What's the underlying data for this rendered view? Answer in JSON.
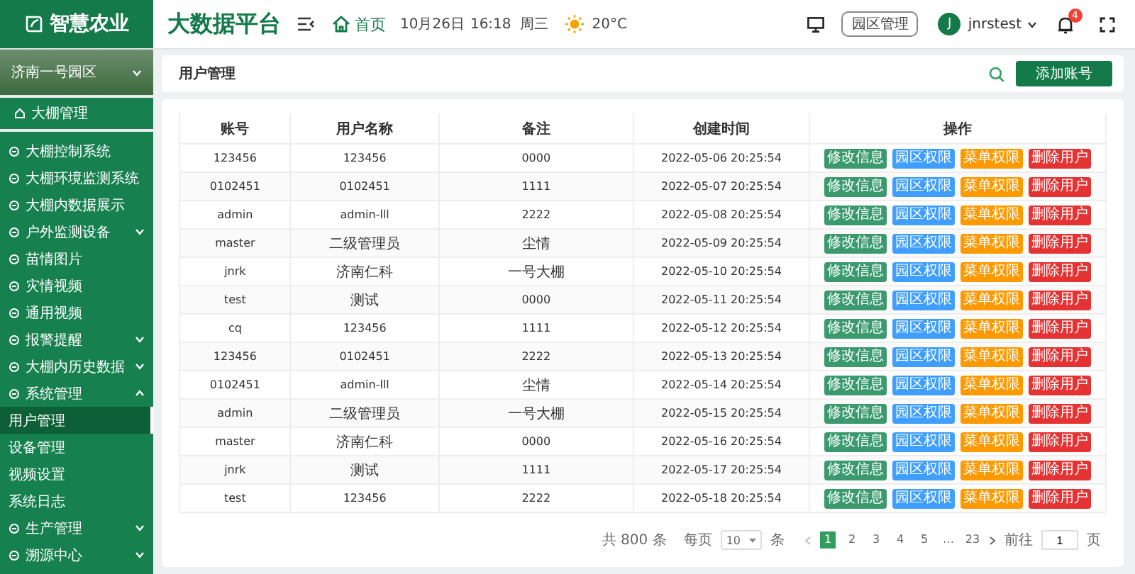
{
  "header": {
    "logo": "智慧农业",
    "platform_title": "大数据平台",
    "home_link": "首页",
    "date": "10月26日",
    "time": "16:18",
    "weekday": "周三",
    "temperature": "20°C",
    "park_button": "园区管理",
    "avatar_letter": "J",
    "username": "jnrstest",
    "notification_count": "4"
  },
  "sidebar": {
    "region": "济南一号园区",
    "top_item": "大棚管理",
    "items": [
      {
        "label": "大棚控制系统"
      },
      {
        "label": "大棚环境监测系统"
      },
      {
        "label": "大棚内数据展示"
      },
      {
        "label": "户外监测设备",
        "expanded": false
      },
      {
        "label": "苗情图片"
      },
      {
        "label": "灾情视频"
      },
      {
        "label": "通用视频"
      },
      {
        "label": "报警提醒",
        "expanded": false
      },
      {
        "label": "大棚内历史数据",
        "expanded": false
      },
      {
        "label": "系统管理",
        "expanded": true,
        "children": [
          {
            "label": "用户管理",
            "selected": true
          },
          {
            "label": "设备管理",
            "selected": false
          },
          {
            "label": "视频设置",
            "selected": false
          },
          {
            "label": "系统日志",
            "selected": false
          }
        ]
      },
      {
        "label": "生产管理",
        "expanded": false
      },
      {
        "label": "溯源中心",
        "expanded": false
      }
    ]
  },
  "page_title": "用户管理",
  "add_button": "添加账号",
  "table": {
    "columns": [
      "账号",
      "用户名称",
      "备注",
      "创建时间",
      "操作"
    ],
    "rows": [
      {
        "cells": [
          "123456",
          "123456",
          "0000",
          "2022-05-06  20:25:54"
        ],
        "actions": [
          {
            "kind": "edit",
            "label": "修改信息"
          },
          {
            "kind": "park",
            "label": "园区权限"
          },
          {
            "kind": "menu",
            "label": "菜单权限"
          },
          {
            "kind": "delete",
            "label": "删除用户"
          }
        ]
      },
      {
        "cells": [
          "0102451",
          "0102451",
          "1111",
          "2022-05-07  20:25:54"
        ],
        "actions": [
          {
            "kind": "edit",
            "label": "修改信息"
          },
          {
            "kind": "park",
            "label": "园区权限"
          },
          {
            "kind": "menu",
            "label": "菜单权限"
          },
          {
            "kind": "delete",
            "label": "删除用户"
          }
        ]
      },
      {
        "cells": [
          "admin",
          "admin-lll",
          "2222",
          "2022-05-08  20:25:54"
        ],
        "actions": [
          {
            "kind": "edit",
            "label": "修改信息"
          },
          {
            "kind": "park",
            "label": "园区权限"
          },
          {
            "kind": "menu",
            "label": "菜单权限"
          },
          {
            "kind": "delete",
            "label": "删除用户"
          }
        ]
      },
      {
        "cells": [
          "master",
          "二级管理员",
          "尘情",
          "2022-05-09  20:25:54"
        ],
        "actions": [
          {
            "kind": "edit",
            "label": "修改信息"
          },
          {
            "kind": "park",
            "label": "园区权限"
          },
          {
            "kind": "menu",
            "label": "菜单权限"
          },
          {
            "kind": "delete",
            "label": "删除用户"
          }
        ]
      },
      {
        "cells": [
          "jnrk",
          "济南仁科",
          "一号大棚",
          "2022-05-10  20:25:54"
        ],
        "actions": [
          {
            "kind": "edit",
            "label": "修改信息"
          },
          {
            "kind": "park",
            "label": "园区权限"
          },
          {
            "kind": "menu",
            "label": "菜单权限"
          },
          {
            "kind": "delete",
            "label": "删除用户"
          }
        ]
      },
      {
        "cells": [
          "test",
          "测试",
          "0000",
          "2022-05-11  20:25:54"
        ],
        "actions": [
          {
            "kind": "edit",
            "label": "修改信息"
          },
          {
            "kind": "park",
            "label": "园区权限"
          },
          {
            "kind": "menu",
            "label": "菜单权限"
          },
          {
            "kind": "delete",
            "label": "删除用户"
          }
        ]
      },
      {
        "cells": [
          "cq",
          "123456",
          "1111",
          "2022-05-12  20:25:54"
        ],
        "actions": [
          {
            "kind": "edit",
            "label": "修改信息"
          },
          {
            "kind": "park",
            "label": "园区权限"
          },
          {
            "kind": "menu",
            "label": "菜单权限"
          },
          {
            "kind": "delete",
            "label": "删除用户"
          }
        ]
      },
      {
        "cells": [
          "123456",
          "0102451",
          "2222",
          "2022-05-13  20:25:54"
        ],
        "actions": [
          {
            "kind": "edit",
            "label": "修改信息"
          },
          {
            "kind": "park",
            "label": "园区权限"
          },
          {
            "kind": "menu",
            "label": "菜单权限"
          },
          {
            "kind": "delete",
            "label": "删除用户"
          }
        ]
      },
      {
        "cells": [
          "0102451",
          "admin-lll",
          "尘情",
          "2022-05-14  20:25:54"
        ],
        "actions": [
          {
            "kind": "edit",
            "label": "修改信息"
          },
          {
            "kind": "park",
            "label": "园区权限"
          },
          {
            "kind": "menu",
            "label": "菜单权限"
          },
          {
            "kind": "delete",
            "label": "删除用户"
          }
        ]
      },
      {
        "cells": [
          "admin",
          "二级管理员",
          "一号大棚",
          "2022-05-15  20:25:54"
        ],
        "actions": [
          {
            "kind": "edit",
            "label": "修改信息"
          },
          {
            "kind": "park",
            "label": "园区权限"
          },
          {
            "kind": "menu",
            "label": "菜单权限"
          },
          {
            "kind": "delete",
            "label": "删除用户"
          }
        ]
      },
      {
        "cells": [
          "master",
          "济南仁科",
          "0000",
          "2022-05-16  20:25:54"
        ],
        "actions": [
          {
            "kind": "edit",
            "label": "修改信息"
          },
          {
            "kind": "park",
            "label": "园区权限"
          },
          {
            "kind": "menu",
            "label": "菜单权限"
          },
          {
            "kind": "delete",
            "label": "删除用户"
          }
        ]
      },
      {
        "cells": [
          "jnrk",
          "测试",
          "1111",
          "2022-05-17  20:25:54"
        ],
        "actions": [
          {
            "kind": "edit",
            "label": "修改信息"
          },
          {
            "kind": "park",
            "label": "园区权限"
          },
          {
            "kind": "menu",
            "label": "菜单权限"
          },
          {
            "kind": "delete",
            "label": "删除用户"
          }
        ]
      },
      {
        "cells": [
          "test",
          "123456",
          "2222",
          "2022-05-18  20:25:54"
        ],
        "actions": [
          {
            "kind": "edit",
            "label": "修改信息"
          },
          {
            "kind": "park",
            "label": "园区权限"
          },
          {
            "kind": "menu",
            "label": "菜单权限"
          },
          {
            "kind": "delete",
            "label": "删除用户"
          }
        ]
      }
    ]
  },
  "pagination": {
    "total": "共 800 条",
    "per_page_label": "每页",
    "per_page": "10",
    "per_page_unit": "条",
    "pages": [
      {
        "label": "1",
        "selected": true
      },
      {
        "label": "2",
        "selected": false
      },
      {
        "label": "3",
        "selected": false
      },
      {
        "label": "4",
        "selected": false
      },
      {
        "label": "5",
        "selected": false
      },
      {
        "label": "…",
        "selected": false
      },
      {
        "label": "23",
        "selected": false
      }
    ],
    "goto_label": "前往",
    "goto_value": "1",
    "goto_unit": "页"
  }
}
